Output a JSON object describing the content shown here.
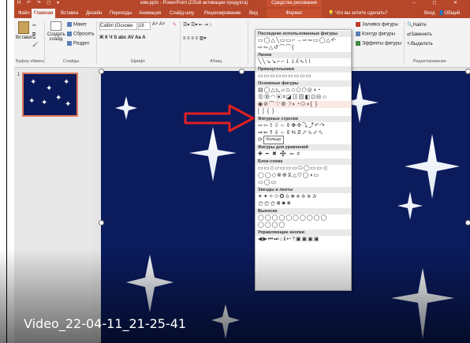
{
  "titlebar": {
    "quick_access": "H ↶ ↷ ◻ ▾",
    "title": "ким.pptx - PowerPoint (Сбой активации продукта)",
    "context_tab_group": "Средства рисования",
    "window_controls": "–  ◻  ✕"
  },
  "tabs": {
    "items": [
      "Файл",
      "Главная",
      "Вставка",
      "Дизайн",
      "Переходы",
      "Анимация",
      "Слайд-шоу",
      "Рецензирование",
      "Вид",
      "Формат"
    ],
    "active": "Главная",
    "tell_me": "Что вы хотите сделать?",
    "sign_in": "Вход",
    "share": "Общий доступ"
  },
  "ribbon": {
    "paste": "Вставить",
    "clipboard_group": "Буфер обмена",
    "layout": "Макет",
    "reset": "Сбросить",
    "new_slide": "Создать слайд",
    "section": "Раздел",
    "slides_group": "Слайды",
    "font_name": "Calibri (Основн",
    "font_size": "18",
    "font_format_row": "Ж  К  Ч  S  abc  AV  Aa  A",
    "font_group": "Шрифт",
    "paragraph_group": "Абзац",
    "shape_fill": "Заливка фигуры",
    "shape_outline": "Контур фигуры",
    "shape_effects": "Эффекты фигуры",
    "find": "Найти",
    "replace": "Заменить",
    "select": "Выделить",
    "editing_group": "Редактирование"
  },
  "thumbnails": [
    {
      "number": "1"
    }
  ],
  "shapes_gallery": {
    "sections": [
      {
        "title": "Последние использованные фигуры",
        "rows": [
          "▭◯△╲▭▭⌐→⇨⇦▭◯△↶",
          "⇨⇦△↺⌒⌒{"
        ]
      },
      {
        "title": "Линии",
        "rows": [
          "╲╲↘↘⌐⌐⇂⇂ʎ∿⌇⌇"
        ]
      },
      {
        "title": "Прямоугольники",
        "rows": [
          "▭▭▭▭▭▭▭▭▭"
        ]
      },
      {
        "title": "Основные фигуры",
        "rows": [
          "▤◯△◺▱⏢◇⬠⬡◎◑◔",
          "⑫⑩◠▣⌗◪▥▨◧⊡⊟☺",
          "◉⊘⌒♡⚙☽◐◔⬭◖{ }",
          "[ ] { }"
        ]
      },
      {
        "title": "Фигурные стрелки",
        "rows": [
          "⇨⇦⇧⇩⇔⇕✥✣⤵⤴↶↷",
          "⇒⇐⇑⇓⇔⇕⇆⇵⬀⬂⬃⬁",
          "⟳⟲↻"
        ]
      },
      {
        "title": "Фигуры для уравнений",
        "rows": [
          "✚ ━ ✖ ➗ ═ ≠"
        ]
      },
      {
        "title": "Блок-схема",
        "rows": [
          "▭▭◇▱▭▭▭⬭◯▭▭◁",
          "◯◯◇⊗⊕⧖△▽◯◑▭",
          "▭◯▭"
        ]
      },
      {
        "title": "Звезды и ленты",
        "rows": [
          "✴✦✧✩✪✫✬✭✮✯✰",
          "⚝⚝⚝❋✹✺"
        ]
      },
      {
        "title": "Выноски",
        "rows": [
          "◯◯◯◯◯◯◯◯◯◯",
          "◯◯◯◯"
        ]
      },
      {
        "title": "Управляющие кнопки",
        "rows": [
          "◀▶⏮⏭⌂ℹ↩?▣▣▣▣"
        ]
      }
    ],
    "tooltip": "Кольцо"
  },
  "video_caption": "Video_22-04-11_21-25-41",
  "colors": {
    "brand": "#b7472a",
    "slide_bg": "#0b1b5c",
    "annotation_arrow": "#e02020"
  }
}
